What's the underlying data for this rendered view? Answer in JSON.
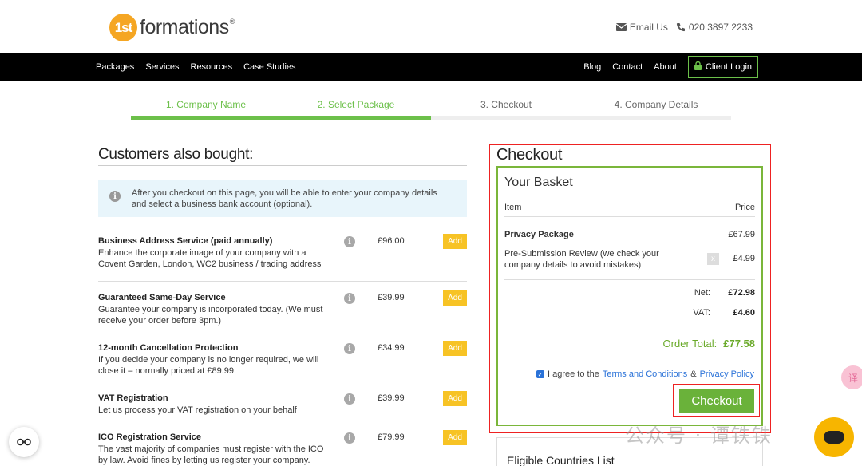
{
  "brand": {
    "logo_mark": "1st",
    "logo_text": "formations",
    "reg": "®"
  },
  "contact": {
    "email": "Email Us",
    "phone": "020 3897 2233"
  },
  "nav": {
    "left": [
      "Packages",
      "Services",
      "Resources",
      "Case Studies"
    ],
    "right": [
      "Blog",
      "Contact",
      "About"
    ],
    "client_login": "Client Login"
  },
  "steps": [
    {
      "label": "1. Company Name",
      "state": "done"
    },
    {
      "label": "2. Select Package",
      "state": "done"
    },
    {
      "label": "3. Checkout",
      "state": "todo"
    },
    {
      "label": "4. Company Details",
      "state": "todo"
    }
  ],
  "left": {
    "title": "Customers also bought:",
    "info": "After you checkout on this page, you will be able to enter your company details and select a business bank account (optional).",
    "addons": [
      {
        "name": "Business Address Service (paid annually)",
        "desc": "Enhance the corporate image of your company with a Covent Garden, London, WC2 business / trading address",
        "price": "£96.00",
        "add": "Add"
      },
      {
        "name": "Guaranteed Same-Day Service",
        "desc": "Guarantee your company is incorporated today. (We must receive your order before 3pm.)",
        "price": "£39.99",
        "add": "Add"
      },
      {
        "name": "12-month Cancellation Protection",
        "desc": "If you decide your company is no longer required, we will close it – normally priced at £89.99",
        "price": "£34.99",
        "add": "Add"
      },
      {
        "name": "VAT Registration",
        "desc": "Let us process your VAT registration on your behalf",
        "price": "£39.99",
        "add": "Add"
      },
      {
        "name": "ICO Registration Service",
        "desc": "The vast majority of companies must register with the ICO by law. Avoid fines by letting us register your company.",
        "price": "£79.99",
        "add": "Add"
      }
    ]
  },
  "checkout": {
    "title": "Checkout",
    "basket_title": "Your Basket",
    "col_item": "Item",
    "col_price": "Price",
    "items": [
      {
        "name": "Privacy Package",
        "price": "£67.99"
      },
      {
        "name": "Pre-Submission Review (we check your company details to avoid mistakes)",
        "price": "£4.99",
        "remove": "x"
      }
    ],
    "net_label": "Net:",
    "net": "£72.98",
    "vat_label": "VAT:",
    "vat": "£4.60",
    "total_label": "Order Total:",
    "total": "£77.58",
    "agree_prefix": "I agree to the",
    "terms": "Terms and Conditions",
    "amp": "&",
    "privacy": "Privacy Policy",
    "button": "Checkout",
    "eligible": "Eligible Countries List"
  },
  "overlay": {
    "watermark": "公众号 · 谭铁铁",
    "translate_badge": "译"
  },
  "colors": {
    "green": "#6cc04a",
    "yellow": "#f7c325",
    "red_annotation": "#e22222",
    "link": "#2a72d8"
  }
}
